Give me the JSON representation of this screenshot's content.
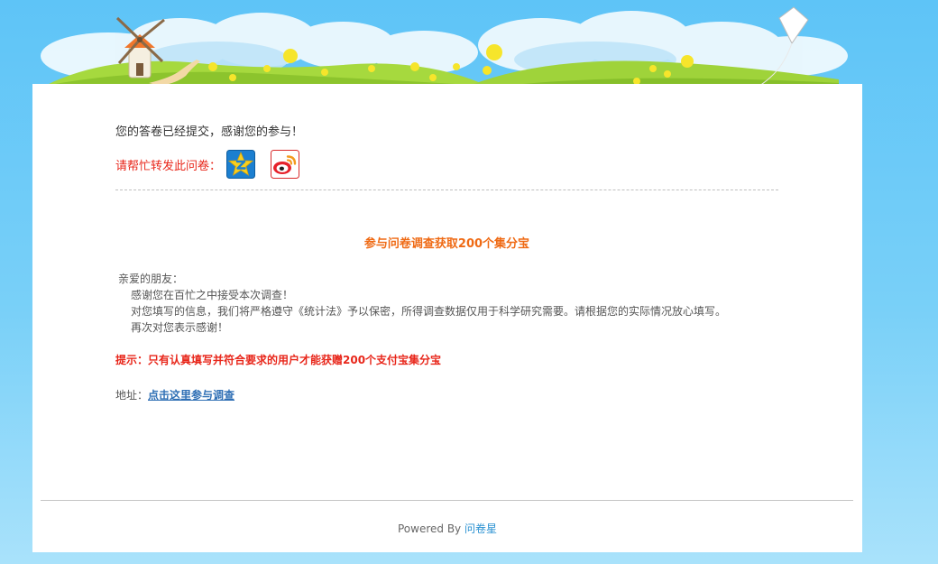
{
  "thanks_text": "您的答卷已经提交，感谢您的参与！",
  "share": {
    "label": "请帮忙转发此问卷：",
    "icons": [
      {
        "name": "qzone-icon"
      },
      {
        "name": "weibo-icon"
      }
    ]
  },
  "promo": {
    "headline": "参与问卷调查获取200个集分宝"
  },
  "letter": {
    "greeting": "亲爱的朋友：",
    "lines": [
      "感谢您在百忙之中接受本次调查！",
      "对您填写的信息，我们将严格遵守《统计法》予以保密，所得调查数据仅用于科学研究需要。请根据您的实际情况放心填写。",
      "再次对您表示感谢！"
    ]
  },
  "tip": "提示：只有认真填写并符合要求的用户才能获赠200个支付宝集分宝",
  "address": {
    "label": "地址：",
    "link_text": "点击这里参与调查"
  },
  "footer": {
    "powered_by": "Powered By",
    "brand": "问卷星"
  },
  "colors": {
    "sky": "#5ec4f7",
    "accent_red": "#e8261a",
    "headline_orange": "#ef6a14",
    "link_blue": "#2f6fb5",
    "footer_link": "#2a91d2"
  }
}
